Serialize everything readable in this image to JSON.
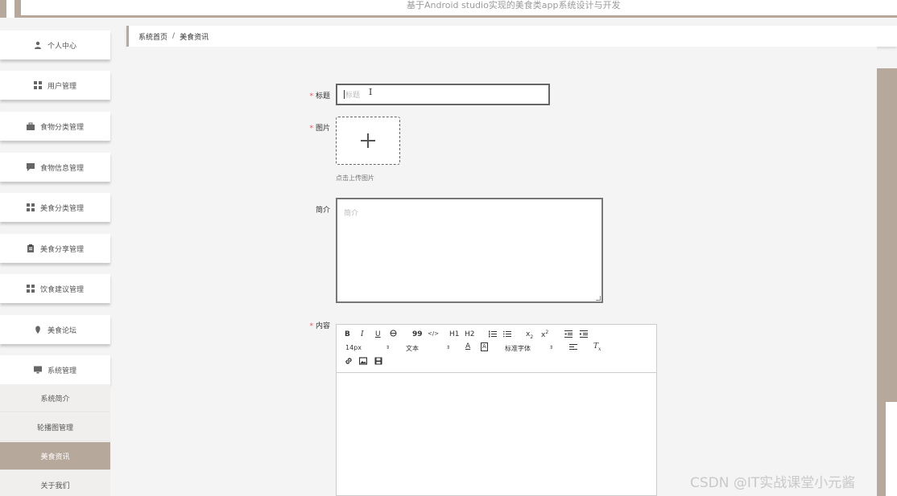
{
  "header": {
    "title": "基于Android studio实现的美食类app系统设计与开发"
  },
  "sidebar": {
    "items": [
      {
        "label": "个人中心",
        "icon": "user-icon"
      },
      {
        "label": "用户管理",
        "icon": "grid-icon"
      },
      {
        "label": "食物分类管理",
        "icon": "briefcase-icon"
      },
      {
        "label": "食物信息管理",
        "icon": "chat-icon"
      },
      {
        "label": "美食分类管理",
        "icon": "grid-icon"
      },
      {
        "label": "美食分享管理",
        "icon": "clipboard-icon"
      },
      {
        "label": "饮食建议管理",
        "icon": "grid-icon"
      },
      {
        "label": "美食论坛",
        "icon": "pin-icon"
      },
      {
        "label": "系统管理",
        "icon": "monitor-icon"
      }
    ],
    "sub_items": [
      {
        "label": "系统简介"
      },
      {
        "label": "轮播图管理"
      },
      {
        "label": "美食资讯",
        "active": true
      },
      {
        "label": "关于我们"
      }
    ]
  },
  "breadcrumb": {
    "home": "系统首页",
    "separator": "/",
    "current": "美食资讯"
  },
  "form": {
    "title_label": "标题",
    "title_placeholder": "标题",
    "image_label": "图片",
    "upload_tip": "点击上传图片",
    "intro_label": "简介",
    "intro_placeholder": "简介",
    "content_label": "内容",
    "required_mark": "*"
  },
  "editor": {
    "font_size": "14px",
    "text_type": "文本",
    "font_family": "标准字体",
    "tools": [
      "B",
      "I",
      "U",
      "S",
      "99",
      "</>",
      "H1",
      "H2",
      "ol",
      "ul",
      "x2",
      "x²",
      "outdent",
      "indent",
      "A",
      "A",
      "align",
      "Tx"
    ]
  },
  "watermark": "CSDN @IT实战课堂小元酱",
  "colors": {
    "accent": "#b7a89c",
    "required": "#ee5555"
  }
}
